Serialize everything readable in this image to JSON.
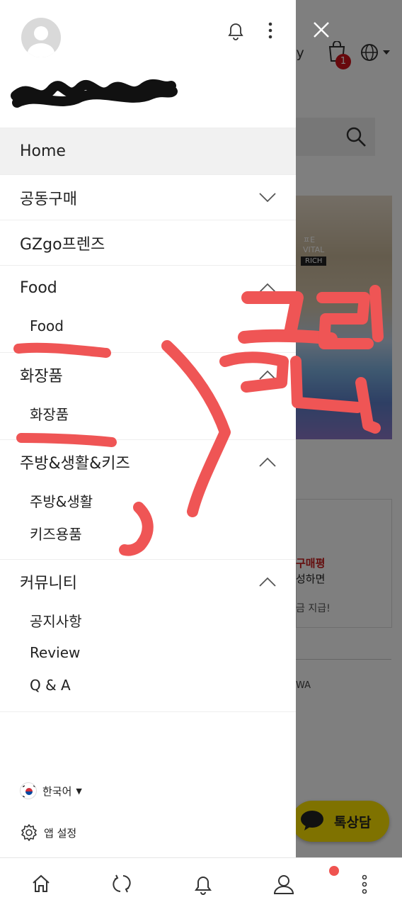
{
  "background_page": {
    "my_label": "my",
    "cart_badge": "1",
    "banner_text_1": "ㅍE",
    "banner_text_2": "VITAL",
    "banner_text_3": "RICH",
    "promo_red": "구매평",
    "promo_black": "성하면",
    "promo_grey": "금 지급!",
    "footer_text": "WA",
    "chat_label": "톡상담"
  },
  "drawer": {
    "menu": {
      "home": "Home",
      "group_buy": "공동구매",
      "friends": "GZgo프렌즈",
      "groups": [
        {
          "title": "Food",
          "items": [
            "Food"
          ]
        },
        {
          "title": "화장품",
          "items": [
            "화장품"
          ]
        },
        {
          "title": "주방&생활&키즈",
          "items": [
            "주방&생활",
            "키즈용품"
          ]
        },
        {
          "title": "커뮤니티",
          "items": [
            "공지사항",
            "Review",
            "Q & A"
          ]
        }
      ]
    },
    "language": "한국어",
    "app_settings": "앱 설정"
  },
  "annotation": {
    "text": "클릭"
  },
  "colors": {
    "annotation_red": "#ef5555",
    "badge_red": "#d0121b",
    "chat_yellow": "#fee500"
  },
  "icons": [
    "bell-icon",
    "more-vertical-icon",
    "close-icon",
    "chevron-down-icon",
    "chevron-up-icon",
    "home-icon",
    "refresh-icon",
    "user-icon",
    "gear-icon",
    "globe-icon",
    "cart-icon",
    "search-icon"
  ]
}
